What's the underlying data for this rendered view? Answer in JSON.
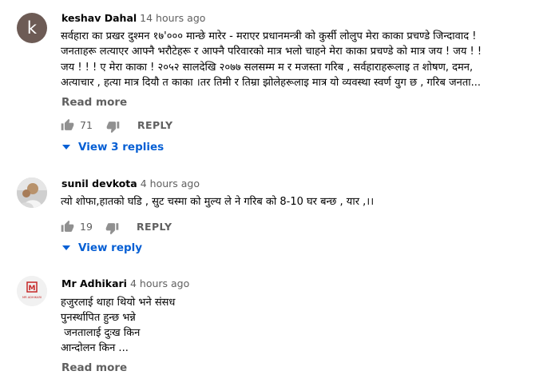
{
  "comments": [
    {
      "avatar_letter": "k",
      "author": "keshav Dahal",
      "time": "14 hours ago",
      "lines": [
        "सर्वहारा का प्रखर दुश्मन १७'००० मान्छे मारेर - मराएर   प्रधानमन्त्री को कुर्सी लोलुप मेरा काका प्रचण्डे जिन्दावाद !",
        "जनताहरू लत्याएर आफ्नै भरौटेहरू र आफ्नै परिवारको मात्र भलो चाहने मेरा काका प्रचण्डे को मात्र जय ! जय ! !",
        "जय ! ! ! ए मेरा काका ! २०५२ सालदेखि २०७७ सलसम्म म र मजस्ता गरिब , सर्वहाराहरूलाइ त शोषण, दमन,",
        "अत्याचार , हत्या मात्र दियौ त काका ।तर तिमी र तिम्रा झोलेहरूलाइ मात्र यो व्यवस्था स्वर्ण युग छ , गरिब जनता..."
      ],
      "read_more": "Read more",
      "likes": "71",
      "reply_label": "REPLY",
      "view_replies": "View 3 replies",
      "like_icon": "thumbs-up-icon",
      "dislike_icon": "thumbs-down-icon"
    },
    {
      "author": "sunil devkota",
      "time": "4 hours ago",
      "lines": [
        "त्यो शोफा,हातको घडि , सुट चस्मा को मुल्य ले ने गरिब को 8-10 घर बन्छ  , यार ,।।"
      ],
      "likes": "19",
      "reply_label": "REPLY",
      "view_replies": "View reply"
    },
    {
      "author": "Mr Adhikari",
      "time": "4 hours ago",
      "avatar_logo_text": "M",
      "avatar_logo_caption": "MR ADHIKARI",
      "lines": [
        "हजुरलाई थाहा थियो भने  संसध",
        "पुनर्स्थापित हुन्छ भन्ने",
        " जनतालाई दुःख किन",
        "आन्दोलन किन ..."
      ],
      "read_more": "Read more"
    }
  ],
  "colors": {
    "link_blue": "#065fd4",
    "muted_gray": "#606060",
    "text": "#030303",
    "avatar_k_bg": "#6d5b55",
    "logo_red": "#c62828"
  }
}
